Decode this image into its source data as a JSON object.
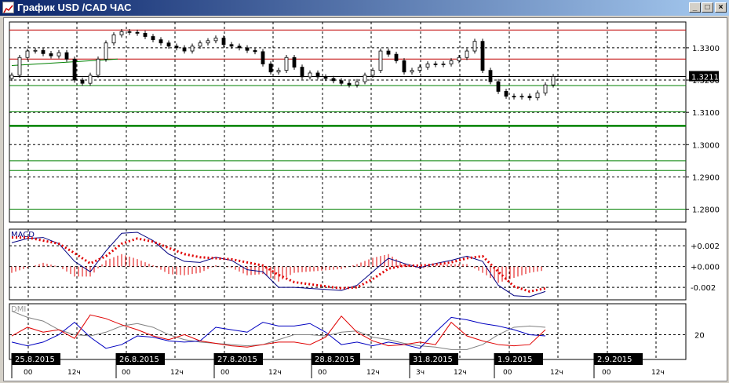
{
  "window": {
    "title": "График USD /CAD  ЧАС",
    "minimize_label": "_",
    "maximize_label": "□",
    "close_label": "×"
  },
  "colors": {
    "bull": "#ffffff",
    "bear": "#000000",
    "resistance": "#c00000",
    "support": "#008000",
    "macd_hist": "#e00000",
    "macd_line": "#000080",
    "signal": "#e00000",
    "adx": "#808080",
    "plus_di": "#0000c0",
    "minus_di": "#e00000"
  },
  "price_axis": {
    "labels": [
      "1.3300",
      "1.3200",
      "1.3100",
      "1.3000",
      "1.2900",
      "1.2800"
    ],
    "current_price": "1.3211"
  },
  "macd_axis": {
    "title": "MACD",
    "labels": [
      "+0.002",
      "+0.000",
      "-0.002"
    ]
  },
  "dmi_axis": {
    "title": "DMI",
    "labels": [
      "20"
    ]
  },
  "dates": [
    "25.8.2015",
    "26.8.2015",
    "27.8.2015",
    "28.8.2015",
    "31.8.2015",
    "1.9.2015",
    "2.9.2015"
  ],
  "hours": [
    "00",
    "12ч",
    "00",
    "12ч",
    "00",
    "12ч",
    "00",
    "12ч",
    "3ч",
    "12ч",
    "00",
    "12ч",
    "00",
    "12ч"
  ],
  "chart_data": [
    {
      "type": "candlestick",
      "title": "USD/CAD H1",
      "ylim": [
        1.276,
        1.338
      ],
      "levels": {
        "resistance": [
          1.3355,
          1.3265
        ],
        "support": [
          1.3183,
          1.3102,
          1.3058,
          1.295,
          1.292,
          1.28
        ]
      },
      "ma_segment": [
        1.3245,
        1.3265
      ],
      "close": [
        1.3215,
        1.327,
        1.329,
        1.3292,
        1.3282,
        1.3275,
        1.3285,
        1.3265,
        1.32,
        1.319,
        1.3215,
        1.3265,
        1.3315,
        1.334,
        1.335,
        1.3348,
        1.3345,
        1.3335,
        1.3325,
        1.3315,
        1.3305,
        1.33,
        1.329,
        1.3305,
        1.3315,
        1.3322,
        1.333,
        1.331,
        1.3305,
        1.33,
        1.3292,
        1.3288,
        1.325,
        1.3225,
        1.323,
        1.327,
        1.324,
        1.321,
        1.3222,
        1.321,
        1.3205,
        1.3198,
        1.319,
        1.3185,
        1.3195,
        1.3215,
        1.323,
        1.329,
        1.328,
        1.326,
        1.3225,
        1.323,
        1.324,
        1.325,
        1.3248,
        1.325,
        1.326,
        1.327,
        1.329,
        1.332,
        1.323,
        1.3195,
        1.3165,
        1.315,
        1.3148,
        1.315,
        1.3145,
        1.316,
        1.3185,
        1.3211
      ]
    },
    {
      "type": "line",
      "title": "MACD",
      "ylim": [
        -0.0032,
        0.0036
      ],
      "macd": [
        0.0023,
        0.0027,
        0.0028,
        0.0022,
        0.0005,
        -0.0005,
        0.0015,
        0.0032,
        0.0033,
        0.0025,
        0.0012,
        0.0005,
        0.0004,
        0.0009,
        0.0006,
        -0.0003,
        -0.0005,
        -0.002,
        -0.002,
        -0.0021,
        -0.0022,
        -0.0023,
        -0.0018,
        -0.0005,
        0.0008,
        0.0003,
        -0.0001,
        0.0003,
        0.0006,
        0.001,
        0.0005,
        -0.0018,
        -0.0028,
        -0.0029,
        -0.0024
      ],
      "signal": [
        0.0028,
        0.0028,
        0.0025,
        0.0022,
        0.0013,
        0.0003,
        0.001,
        0.0022,
        0.0027,
        0.0024,
        0.0018,
        0.0012,
        0.0009,
        0.0008,
        0.0007,
        0.0004,
        0.0001,
        -0.0008,
        -0.0015,
        -0.0017,
        -0.0019,
        -0.0021,
        -0.002,
        -0.0012,
        -0.0002,
        0.0001,
        0.0001,
        0.0002,
        0.0004,
        0.0008,
        0.001,
        -0.0005,
        -0.0019,
        -0.0024,
        -0.0021
      ]
    },
    {
      "type": "line",
      "title": "DMI",
      "ylim": [
        0,
        45
      ],
      "adx": [
        39,
        34,
        31,
        24,
        20,
        19,
        22,
        27,
        29,
        26,
        20,
        16,
        14,
        13,
        12,
        11,
        12,
        16,
        20,
        20,
        19,
        22,
        23,
        18,
        16,
        13,
        11,
        10,
        8,
        8,
        12,
        20,
        26,
        27,
        26
      ],
      "plus_di": [
        14,
        11,
        14,
        20,
        30,
        18,
        9,
        12,
        19,
        18,
        15,
        14,
        15,
        26,
        24,
        22,
        30,
        27,
        27,
        29,
        22,
        12,
        14,
        11,
        14,
        12,
        9,
        22,
        34,
        32,
        29,
        27,
        24,
        20,
        19
      ],
      "minus_di": [
        19,
        26,
        22,
        24,
        17,
        36,
        33,
        28,
        24,
        19,
        16,
        20,
        15,
        13,
        11,
        10,
        12,
        14,
        14,
        12,
        18,
        35,
        22,
        15,
        11,
        12,
        14,
        12,
        30,
        19,
        15,
        12,
        11,
        12,
        24
      ]
    }
  ]
}
